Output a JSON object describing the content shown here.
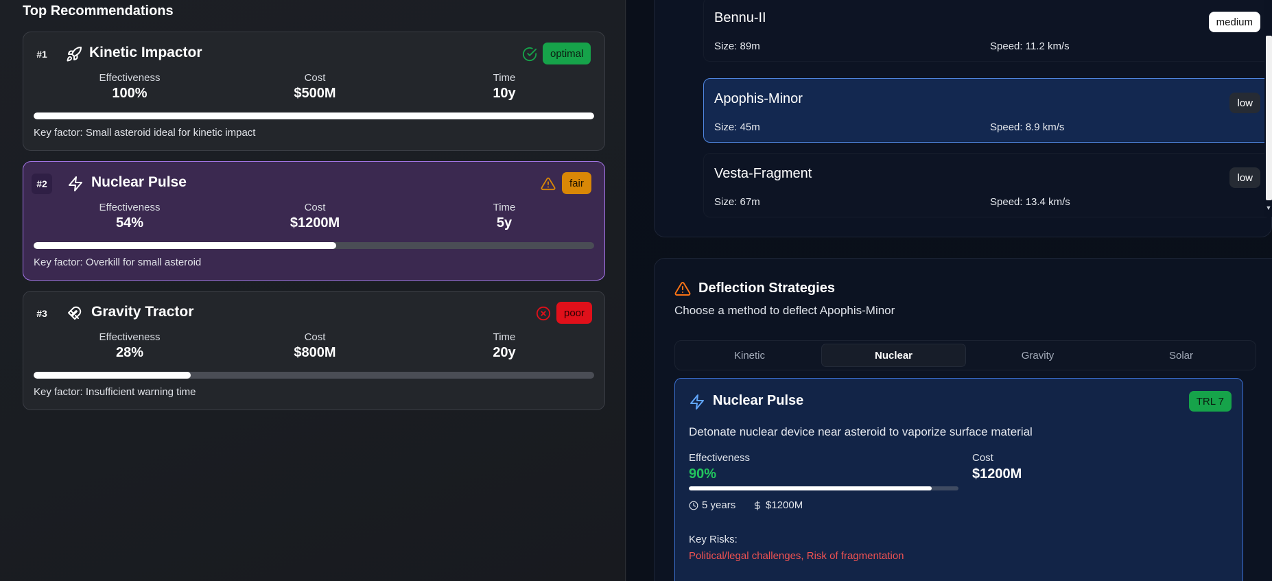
{
  "left": {
    "title": "Top Recommendations",
    "cards": [
      {
        "rank": "#1",
        "name": "Kinetic Impactor",
        "icon": "rocket-icon",
        "status": "optimal",
        "metrics": {
          "effectiveness_label": "Effectiveness",
          "effectiveness": "100%",
          "cost_label": "Cost",
          "cost": "$500M",
          "time_label": "Time",
          "time": "10y"
        },
        "progress": 1.0,
        "key_factor": "Key factor: Small asteroid ideal for kinetic impact"
      },
      {
        "rank": "#2",
        "name": "Nuclear Pulse",
        "icon": "lightning-icon",
        "status": "fair",
        "metrics": {
          "effectiveness_label": "Effectiveness",
          "effectiveness": "54%",
          "cost_label": "Cost",
          "cost": "$1200M",
          "time_label": "Time",
          "time": "5y"
        },
        "progress": 0.54,
        "key_factor": "Key factor: Overkill for small asteroid"
      },
      {
        "rank": "#3",
        "name": "Gravity Tractor",
        "icon": "magnet-icon",
        "status": "poor",
        "metrics": {
          "effectiveness_label": "Effectiveness",
          "effectiveness": "28%",
          "cost_label": "Cost",
          "cost": "$800M",
          "time_label": "Time",
          "time": "20y"
        },
        "progress": 0.28,
        "key_factor": "Key factor: Insufficient warning time"
      }
    ]
  },
  "asteroids": [
    {
      "name": "Bennu-II",
      "risk": "medium",
      "size": "Size: 89m",
      "speed": "Speed: 11.2 km/s"
    },
    {
      "name": "Apophis-Minor",
      "risk": "low",
      "size": "Size: 45m",
      "speed": "Speed: 8.9 km/s"
    },
    {
      "name": "Vesta-Fragment",
      "risk": "low",
      "size": "Size: 67m",
      "speed": "Speed: 13.4 km/s"
    }
  ],
  "strategies": {
    "title": "Deflection Strategies",
    "subtitle": "Choose a method to deflect Apophis-Minor",
    "tabs": [
      "Kinetic",
      "Nuclear",
      "Gravity",
      "Solar"
    ],
    "active_tab": "Nuclear",
    "method": {
      "name": "Nuclear Pulse",
      "trl": "TRL 7",
      "description": "Detonate nuclear device near asteroid to vaporize surface material",
      "effectiveness_label": "Effectiveness",
      "effectiveness": "90%",
      "effectiveness_fraction": 0.9,
      "cost_label": "Cost",
      "cost": "$1200M",
      "duration": "5 years",
      "meta_cost": "$1200M",
      "risks_label": "Key Risks:",
      "risks": "Political/legal challenges, Risk of fragmentation"
    }
  },
  "colors": {
    "optimal": "#16a34a",
    "fair": "#d98706",
    "poor": "#e0101a",
    "accent_blue": "#4f86e0",
    "risk_text": "#f05252",
    "effectiveness_green": "#22c55e"
  }
}
